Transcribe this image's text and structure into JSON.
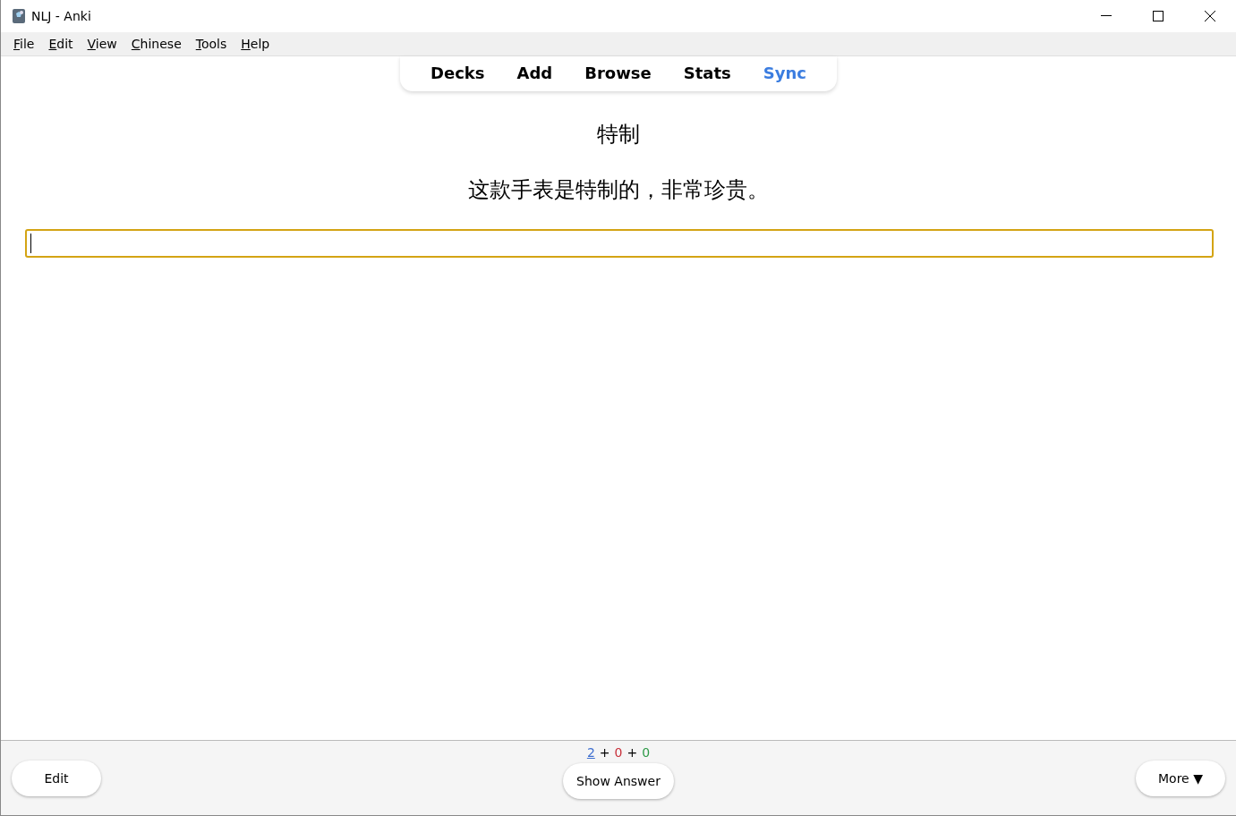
{
  "window": {
    "title": "NLJ - Anki"
  },
  "menu": [
    "File",
    "Edit",
    "View",
    "Chinese",
    "Tools",
    "Help"
  ],
  "toplinks": [
    {
      "label": "Decks",
      "color": "#000000"
    },
    {
      "label": "Add",
      "color": "#000000"
    },
    {
      "label": "Browse",
      "color": "#000000"
    },
    {
      "label": "Stats",
      "color": "#000000"
    },
    {
      "label": "Sync",
      "color": "#3b7de0"
    }
  ],
  "card": {
    "word": "特制",
    "sentence": "这款手表是特制的，非常珍贵。",
    "answer_field": {
      "focused": true
    }
  },
  "bottom_bar": {
    "counts": [
      {
        "text": "2",
        "color": "#3f6fd0",
        "current": true
      },
      {
        "text": "+",
        "color": "#000000",
        "current": false
      },
      {
        "text": "0",
        "color": "#c8303a",
        "current": false
      },
      {
        "text": "+",
        "color": "#000000",
        "current": false
      },
      {
        "text": "0",
        "color": "#2e9a48",
        "current": false
      }
    ],
    "edit_button": "Edit",
    "show_answer_button": "Show Answer",
    "more_button": "More ▼"
  }
}
